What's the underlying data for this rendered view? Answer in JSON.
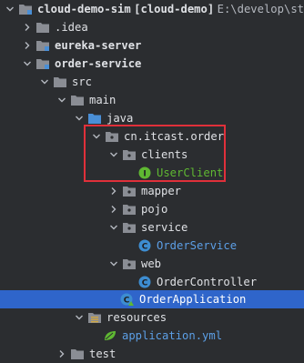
{
  "project": {
    "name": "cloud-demo-sim",
    "module": "[cloud-demo]",
    "path": "E:\\develop\\st"
  },
  "items": {
    "idea": ".idea",
    "eureka": "eureka-server",
    "order": "order-service",
    "src": "src",
    "main": "main",
    "java": "java",
    "pkg": "cn.itcast.order",
    "clients": "clients",
    "userclient": "UserClient",
    "mapper": "mapper",
    "pojo": "pojo",
    "service": "service",
    "orderservice": "OrderService",
    "web": "web",
    "ordercontroller": "OrderController",
    "orderapplication": "OrderApplication",
    "resources": "resources",
    "appyml": "application.yml",
    "test": "test"
  },
  "colors": {
    "background": "#2b2d30",
    "selection": "#2f65ca",
    "highlight_border": "#e0303a",
    "folder": "#8a8d94",
    "source_folder": "#4a8fd6",
    "class_icon": "#3d8dd1",
    "interface_icon": "#5fb832"
  }
}
